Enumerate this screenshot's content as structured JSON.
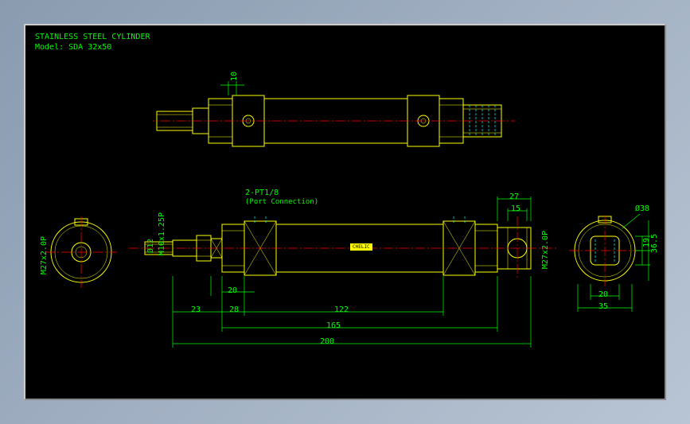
{
  "title_block": {
    "line1": "STAINLESS STEEL CYLINDER",
    "line2": "Model: SDA 32x50"
  },
  "port_annotation": {
    "label": "2-PT1/8",
    "sub": "(Port Connection)"
  },
  "brand_badge": "CHELIC",
  "dimensions": {
    "top_dim_10": "10",
    "front_overall_200": "200",
    "front_165": "165",
    "front_122": "122",
    "front_23": "23",
    "front_28": "28",
    "front_20_left": "20",
    "front_27": "27",
    "front_15": "15",
    "rod_dia_12": "Ø12",
    "thread_m10": "M10x1.25P",
    "thread_m27_left": "M27x2.0P",
    "thread_m27_right": "M27x2.0P",
    "right_dia_38": "Ø38",
    "right_19": "19",
    "right_36_5": "36.5",
    "right_20": "20",
    "right_35": "35"
  }
}
